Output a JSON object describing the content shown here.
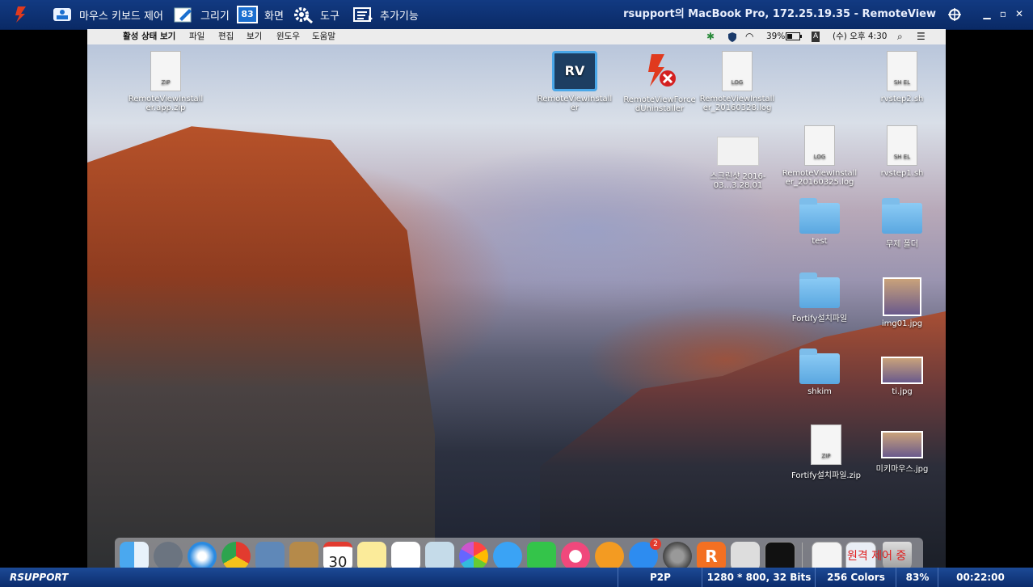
{
  "toolbar": {
    "items": [
      {
        "label": "마우스 키보드 제어",
        "icon": "mouse-keyboard-icon"
      },
      {
        "label": "그리기",
        "icon": "draw-icon"
      },
      {
        "label": "화면",
        "icon": "screen-icon",
        "badge": "83"
      },
      {
        "label": "도구",
        "icon": "tools-icon"
      },
      {
        "label": "추가기능",
        "icon": "extension-icon"
      }
    ],
    "window_title": "rsupport의 MacBook Pro, 172.25.19.35 - RemoteView"
  },
  "mac_menubar": {
    "items": [
      "활성 상태 보기",
      "파일",
      "편집",
      "보기",
      "윈도우",
      "도움말"
    ],
    "battery": "39%",
    "clock": "(수) 오후 4:30",
    "input_badge": "A"
  },
  "desktop_icons": [
    {
      "label": "RemoteViewInstall er.app.zip",
      "type": "zip",
      "doc_text": "ZIP"
    },
    {
      "label": "RemoteViewInstall er",
      "type": "rv"
    },
    {
      "label": "RemoteViewForce dUninstaller",
      "type": "uninstall"
    },
    {
      "label": "RemoteViewInstall er_20160328.log",
      "type": "log",
      "doc_text": "LOG"
    },
    {
      "label": "rvstep2.sh",
      "type": "sh",
      "doc_text": "SH EL"
    },
    {
      "label": "스크린샷 2016-03...3.28.01",
      "type": "screenshot"
    },
    {
      "label": "RemoteViewInstall er_20160325.log",
      "type": "log",
      "doc_text": "LOG"
    },
    {
      "label": "rvstep1.sh",
      "type": "sh",
      "doc_text": "SH EL"
    },
    {
      "label": "test",
      "type": "folder"
    },
    {
      "label": "무제 폴더",
      "type": "folder"
    },
    {
      "label": "Fortify설치파일",
      "type": "folder"
    },
    {
      "label": "img01.jpg",
      "type": "photo"
    },
    {
      "label": "shkim",
      "type": "folder"
    },
    {
      "label": "ti.jpg",
      "type": "photo"
    },
    {
      "label": "Fortify설치파일.zip",
      "type": "zip",
      "doc_text": "ZIP"
    },
    {
      "label": "미키마우스.jpg",
      "type": "photo"
    }
  ],
  "dock": {
    "calendar_day": "30",
    "appstore_badge": "2",
    "overlay_text": "원격 제어 중"
  },
  "statusbar": {
    "brand": "RSUPPORT",
    "mode": "P2P",
    "resolution": "1280 * 800, 32 Bits",
    "colors": "256 Colors",
    "zoom": "83%",
    "elapsed": "00:22:00"
  },
  "colors": {
    "toolbar": "#123a82",
    "statusbar": "#1c4a96",
    "accent": "#d63b1f"
  }
}
